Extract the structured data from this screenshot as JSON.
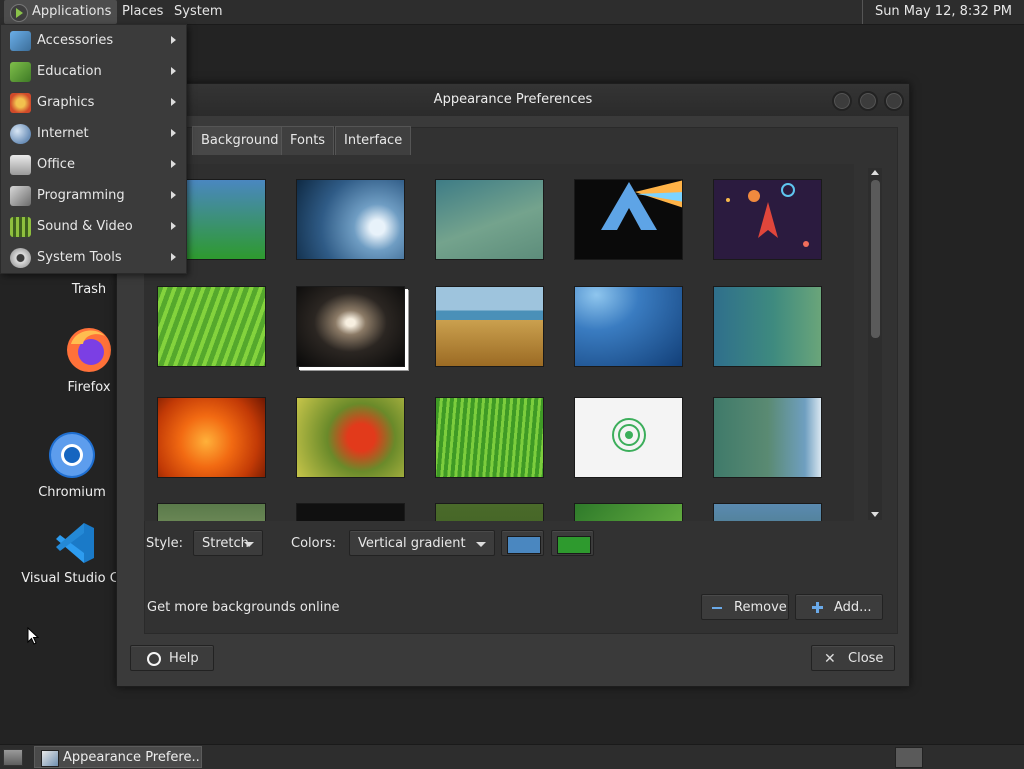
{
  "top_panel": {
    "menus": [
      "Applications",
      "Places",
      "System"
    ],
    "clock": "Sun May 12,  8:32 PM"
  },
  "apps_menu": {
    "items": [
      {
        "label": "Accessories",
        "icon": "accessories-icon"
      },
      {
        "label": "Education",
        "icon": "education-icon"
      },
      {
        "label": "Graphics",
        "icon": "graphics-icon"
      },
      {
        "label": "Internet",
        "icon": "internet-icon"
      },
      {
        "label": "Office",
        "icon": "office-icon"
      },
      {
        "label": "Programming",
        "icon": "programming-icon"
      },
      {
        "label": "Sound & Video",
        "icon": "sound-video-icon"
      },
      {
        "label": "System Tools",
        "icon": "system-tools-icon"
      }
    ]
  },
  "desktop": {
    "icons": [
      {
        "label": "Trash",
        "icon": "trash-icon"
      },
      {
        "label": "Firefox",
        "icon": "firefox-icon"
      },
      {
        "label": "Chromium",
        "icon": "chromium-icon"
      },
      {
        "label": "Visual Studio Co",
        "icon": "vscode-icon"
      }
    ]
  },
  "dialog": {
    "title": "Appearance Preferences",
    "tabs": [
      "Background",
      "Fonts",
      "Interface"
    ],
    "active_tab": "Background",
    "style_label": "Style:",
    "style_value": "Stretch",
    "colors_label": "Colors:",
    "colors_value": "Vertical gradient",
    "primary_color": "#4a87c0",
    "secondary_color": "#2e9a2e",
    "get_more_link": "Get more backgrounds online",
    "remove_label": "Remove",
    "add_label": "Add...",
    "help_label": "Help",
    "close_label": "Close"
  },
  "taskbar": {
    "window_button": "Appearance Prefere..."
  }
}
